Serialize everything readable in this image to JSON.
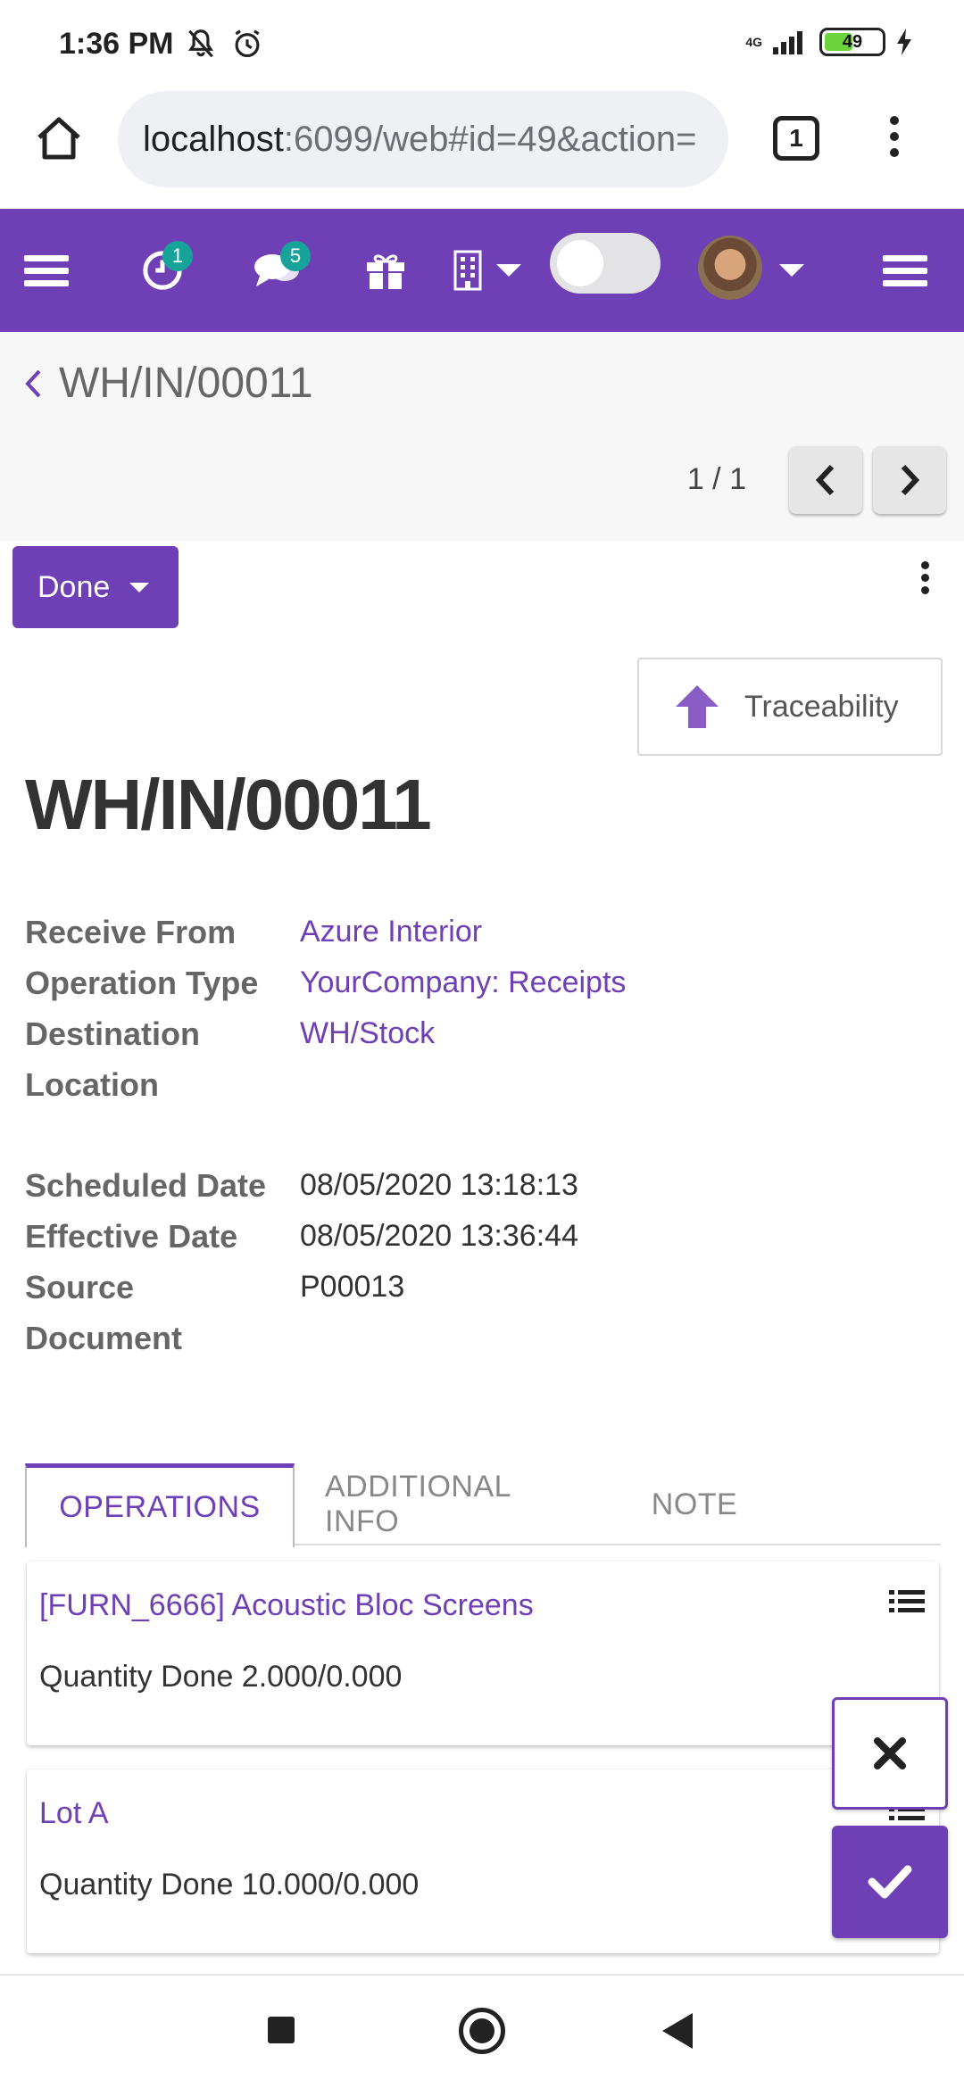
{
  "status_bar": {
    "time": "1:36 PM",
    "network": "4G",
    "battery": "49"
  },
  "browser": {
    "url_host": "localhost",
    "url_rest": ":6099/web#id=49&action=",
    "tab_count": "1"
  },
  "navbar": {
    "activity_count": "1",
    "message_count": "5"
  },
  "breadcrumb": {
    "title": "WH/IN/00011"
  },
  "pager": {
    "value": "1 / 1"
  },
  "status": {
    "done_label": "Done"
  },
  "smart_button": {
    "traceability_label": "Traceability"
  },
  "record": {
    "name": "WH/IN/00011",
    "fields": {
      "receive_from_label": "Receive From",
      "receive_from": "Azure Interior",
      "operation_type_label": "Operation Type",
      "operation_type": "YourCompany: Receipts",
      "destination_label_1": "Destination",
      "destination_label_2": "Location",
      "destination": "WH/Stock",
      "scheduled_label": "Scheduled Date",
      "scheduled": "08/05/2020 13:18:13",
      "effective_label": "Effective Date",
      "effective": "08/05/2020 13:36:44",
      "source_label_1": "Source",
      "source_label_2": "Document",
      "source": "P00013"
    }
  },
  "notebook": {
    "tabs": [
      {
        "label": "OPERATIONS"
      },
      {
        "label": "ADDITIONAL INFO"
      },
      {
        "label": "NOTE"
      }
    ]
  },
  "operations": [
    {
      "name": "[FURN_6666] Acoustic Bloc Screens",
      "qty": "Quantity Done 2.000/0.000"
    },
    {
      "name": "Lot A",
      "qty": "Quantity Done 10.000/0.000"
    }
  ],
  "colors": {
    "brand": "#6f3fb6",
    "badge": "#18a39a"
  }
}
